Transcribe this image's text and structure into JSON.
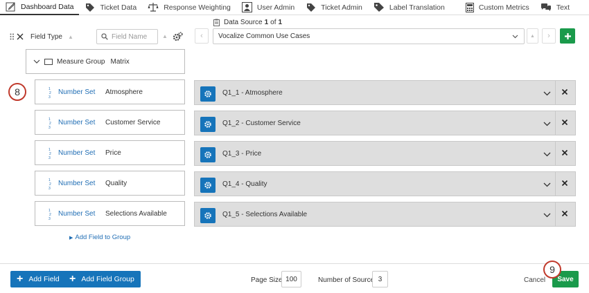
{
  "tabs": [
    {
      "label": "Dashboard Data",
      "icon": "pencil-icon",
      "active": true
    },
    {
      "label": "Ticket Data",
      "icon": "tag-icon"
    },
    {
      "label": "Response Weighting",
      "icon": "scale-icon"
    },
    {
      "label": "User Admin",
      "icon": "user-icon"
    },
    {
      "label": "Ticket Admin",
      "icon": "tag-icon"
    },
    {
      "label": "Label Translation",
      "icon": "label-icon"
    },
    {
      "label": "Custom Metrics",
      "icon": "calculator-icon"
    },
    {
      "label": "Text",
      "icon": "speech-bubble-icon"
    }
  ],
  "data_source": {
    "prefix": "Data Source",
    "current": "1",
    "of_word": "of",
    "total": "1",
    "selected": "Vocalize Common Use Cases"
  },
  "toolbar": {
    "field_type_label": "Field Type",
    "field_name_placeholder": "Field Name"
  },
  "group": {
    "label": "Measure Group",
    "name": "Matrix"
  },
  "fields": [
    {
      "type": "Number Set",
      "label": "Atmosphere",
      "mapping": "Q1_1 - Atmosphere"
    },
    {
      "type": "Number Set",
      "label": "Customer Service",
      "mapping": "Q1_2 - Customer Service"
    },
    {
      "type": "Number Set",
      "label": "Price",
      "mapping": "Q1_3 - Price"
    },
    {
      "type": "Number Set",
      "label": "Quality",
      "mapping": "Q1_4 - Quality"
    },
    {
      "type": "Number Set",
      "label": "Selections Available",
      "mapping": "Q1_5 - Selections Available"
    }
  ],
  "add_field_to_group": "Add Field to Group",
  "markers": {
    "left": "8",
    "save": "9"
  },
  "footer": {
    "add_field": "Add Field",
    "add_field_group": "Add Field Group",
    "page_size_label": "Page Size:",
    "page_size_value": "100",
    "sources_label": "Number of Sources:",
    "sources_value": "3",
    "cancel": "Cancel",
    "save": "Save"
  },
  "colors": {
    "primary_blue": "#1674ba",
    "green": "#1a9a4b",
    "marker_red": "#c0392b"
  }
}
